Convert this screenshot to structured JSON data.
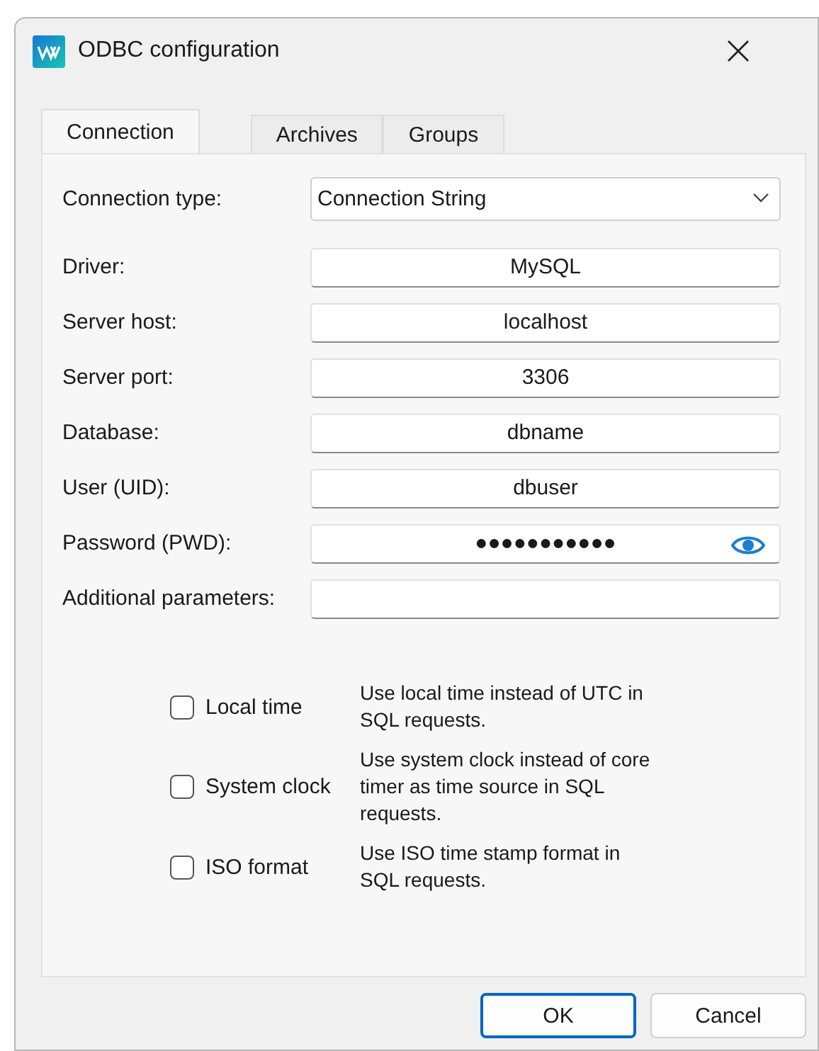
{
  "window": {
    "title": "ODBC configuration"
  },
  "tabs": [
    {
      "label": "Connection",
      "selected": true
    },
    {
      "label": "Archives",
      "selected": false
    },
    {
      "label": "Groups",
      "selected": false
    }
  ],
  "connection_type": {
    "label": "Connection type:",
    "value": "Connection String"
  },
  "fields": [
    {
      "label": "Driver:",
      "value": "MySQL",
      "kind": "text"
    },
    {
      "label": "Server host:",
      "value": "localhost",
      "kind": "text"
    },
    {
      "label": "Server port:",
      "value": "3306",
      "kind": "text"
    },
    {
      "label": "Database:",
      "value": "dbname",
      "kind": "text"
    },
    {
      "label": "User (UID):",
      "value": "dbuser",
      "kind": "text"
    },
    {
      "label": "Password (PWD):",
      "value": "●●●●●●●●●●●",
      "kind": "password"
    },
    {
      "label": "Additional parameters:",
      "kind": "text"
    }
  ],
  "options": [
    {
      "label": "Local time",
      "checked": false,
      "description": "Use local time instead of UTC in SQL requests."
    },
    {
      "label": "System clock",
      "checked": false,
      "description": "Use system clock instead of core timer as time source in SQL requests."
    },
    {
      "label": "ISO format",
      "checked": false,
      "description": "Use ISO time stamp format in SQL requests."
    }
  ],
  "buttons": [
    {
      "label": "OK",
      "default": true
    },
    {
      "label": "Cancel",
      "default": false
    }
  ]
}
